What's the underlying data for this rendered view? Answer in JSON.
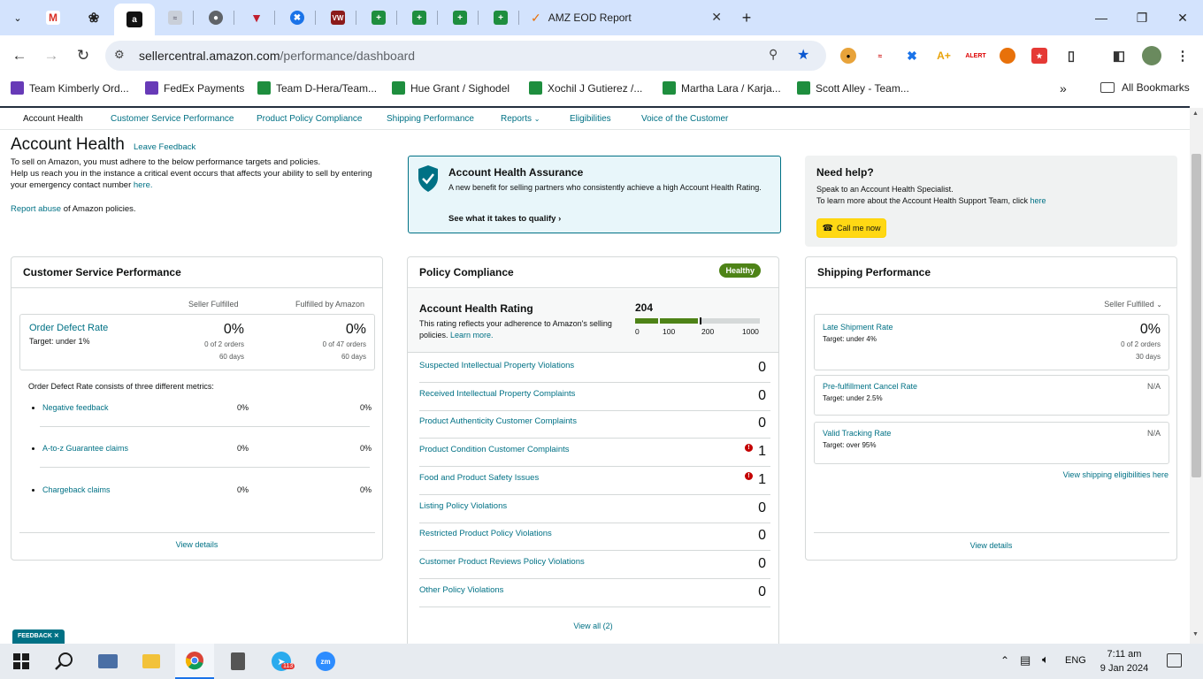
{
  "browser": {
    "active_tab_title": "AMZ EOD Report",
    "url_domain": "sellercentral.amazon.com",
    "url_path": "/performance/dashboard",
    "bookmarks": [
      "Team Kimberly Ord...",
      "FedEx Payments",
      "Team D-Hera/Team...",
      "Hue Grant / Sighodel",
      "Xochil J Gutierez /...",
      "Martha Lara / Karja...",
      "Scott Alley - Team..."
    ],
    "all_bookmarks": "All Bookmarks",
    "colors": {
      "tabbar": "#d3e3fd",
      "accent": "#007185"
    }
  },
  "subnav": {
    "items": [
      "Account Health",
      "Customer Service Performance",
      "Product Policy Compliance",
      "Shipping Performance",
      "Reports",
      "Eligibilities",
      "Voice of the Customer"
    ]
  },
  "header": {
    "title": "Account Health",
    "leave_feedback": "Leave Feedback",
    "line1": "To sell on Amazon, you must adhere to the below performance targets and policies.",
    "line2": "Help us reach you in the instance a critical event occurs that affects your ability to sell by entering your emergency contact number",
    "here": "here.",
    "report_abuse": "Report abuse",
    "report_abuse_rest": "of Amazon policies."
  },
  "assurance": {
    "title": "Account Health Assurance",
    "desc": "A new benefit for selling partners who consistently achieve a high Account Health Rating.",
    "link": "See what it takes to qualify"
  },
  "help": {
    "title": "Need help?",
    "line1": "Speak to an Account Health Specialist.",
    "line2": "To learn more about the Account Health Support Team, click",
    "here": "here",
    "call_button": "Call me now"
  },
  "csp": {
    "title": "Customer Service Performance",
    "col1": "Seller Fulfilled",
    "col2": "Fulfilled by Amazon",
    "odr_label": "Order Defect Rate",
    "odr_target": "Target: under 1%",
    "sf_pct": "0%",
    "sf_orders": "0 of 2 orders",
    "sf_days": "60 days",
    "fba_pct": "0%",
    "fba_orders": "0 of 47 orders",
    "fba_days": "60 days",
    "metrics_intro": "Order Defect Rate consists of three different metrics:",
    "metrics": [
      {
        "name": "Negative feedback",
        "sf": "0%",
        "fba": "0%"
      },
      {
        "name": "A-to-z Guarantee claims",
        "sf": "0%",
        "fba": "0%"
      },
      {
        "name": "Chargeback claims",
        "sf": "0%",
        "fba": "0%"
      }
    ],
    "view_details": "View details"
  },
  "policy": {
    "title": "Policy Compliance",
    "badge": "Healthy",
    "ahr_title": "Account Health Rating",
    "ahr_desc": "This rating reflects your adherence to Amazon's selling policies.",
    "learn_more": "Learn more.",
    "ahr_value": "204",
    "scale_ticks": [
      "0",
      "100",
      "200",
      "1000"
    ],
    "rating_max": 1000,
    "rows": [
      {
        "label": "Suspected Intellectual Property Violations",
        "value": "0",
        "warn": false
      },
      {
        "label": "Received Intellectual Property Complaints",
        "value": "0",
        "warn": false
      },
      {
        "label": "Product Authenticity Customer Complaints",
        "value": "0",
        "warn": false
      },
      {
        "label": "Product Condition Customer Complaints",
        "value": "1",
        "warn": true
      },
      {
        "label": "Food and Product Safety Issues",
        "value": "1",
        "warn": true
      },
      {
        "label": "Listing Policy Violations",
        "value": "0",
        "warn": false
      },
      {
        "label": "Restricted Product Policy Violations",
        "value": "0",
        "warn": false
      },
      {
        "label": "Customer Product Reviews Policy Violations",
        "value": "0",
        "warn": false
      },
      {
        "label": "Other Policy Violations",
        "value": "0",
        "warn": false
      }
    ],
    "view_all": "View all (2)"
  },
  "shipping": {
    "title": "Shipping Performance",
    "filter": "Seller Fulfilled",
    "late_label": "Late Shipment Rate",
    "late_target": "Target: under 4%",
    "late_pct": "0%",
    "late_orders": "0 of 2 orders",
    "late_days": "30 days",
    "cancel_label": "Pre-fulfillment Cancel Rate",
    "cancel_target": "Target: under 2.5%",
    "cancel_value": "N/A",
    "track_label": "Valid Tracking Rate",
    "track_target": "Target: over 95%",
    "track_value": "N/A",
    "eligibilities": "View shipping eligibilities here",
    "view_details": "View details"
  },
  "feedback_tab": "FEEDBACK",
  "taskbar": {
    "lang": "ENG",
    "time": "7:11 am",
    "date": "9 Jan 2024",
    "telegram_badge": "113"
  }
}
